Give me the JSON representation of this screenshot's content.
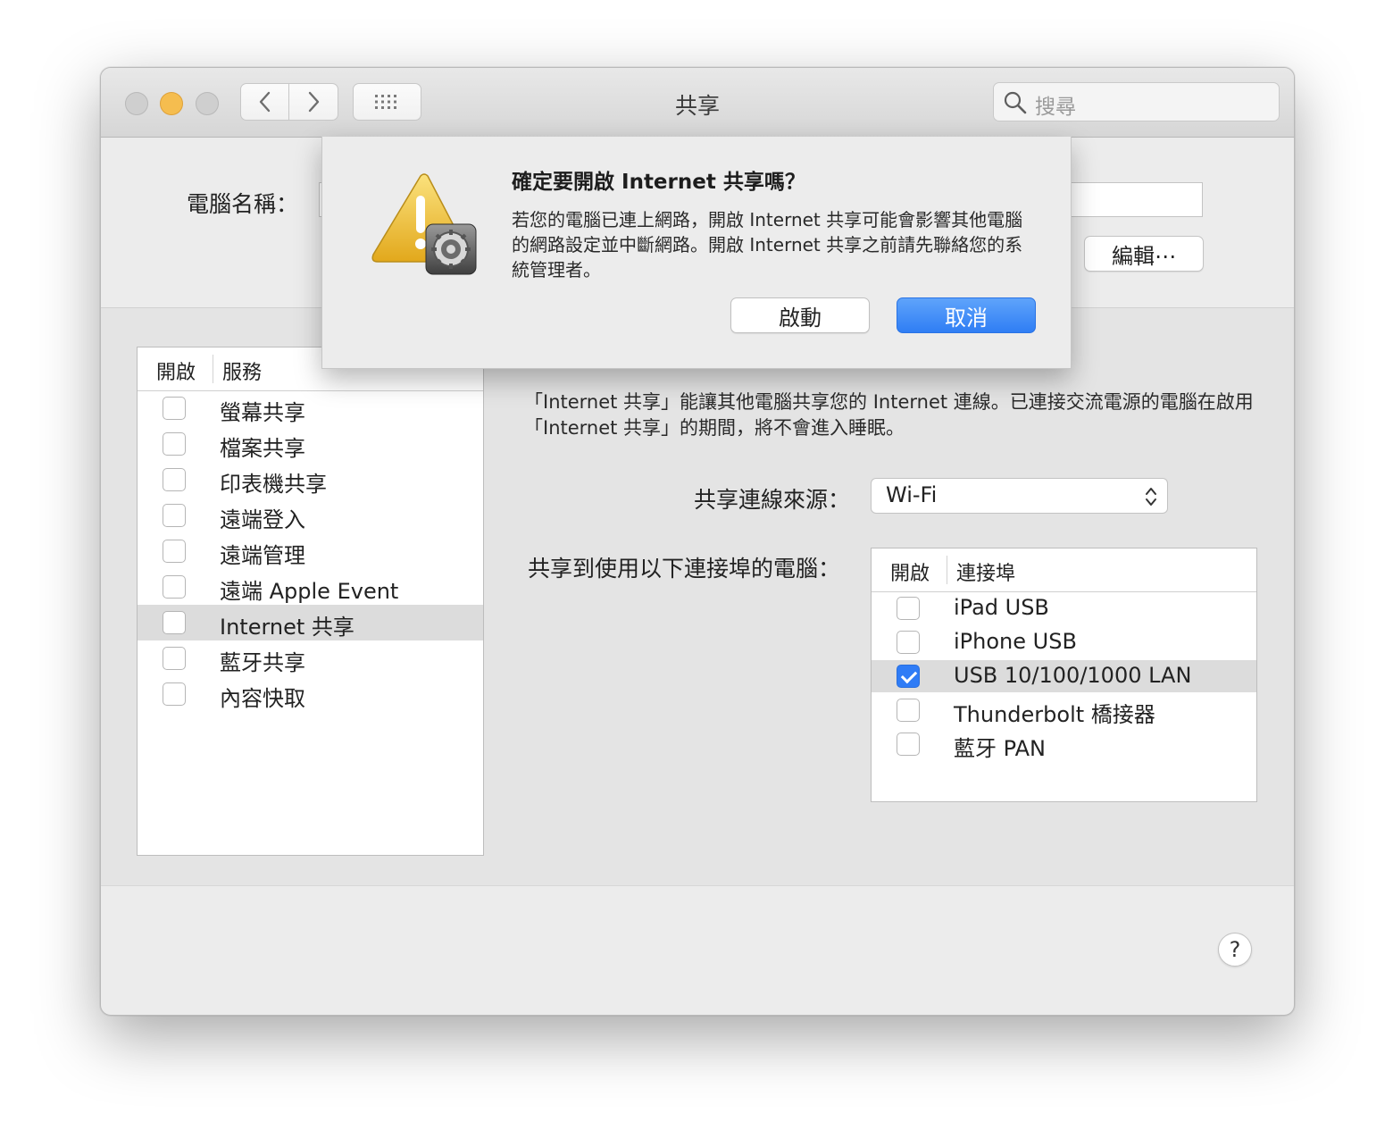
{
  "window": {
    "title": "共享"
  },
  "search": {
    "placeholder": "搜尋"
  },
  "computer_name": {
    "label": "電腦名稱：",
    "edit_button": "編輯⋯"
  },
  "services": {
    "header_on": "開啟",
    "header_service": "服務",
    "items": [
      {
        "label": "螢幕共享",
        "checked": false,
        "selected": false
      },
      {
        "label": "檔案共享",
        "checked": false,
        "selected": false
      },
      {
        "label": "印表機共享",
        "checked": false,
        "selected": false
      },
      {
        "label": "遠端登入",
        "checked": false,
        "selected": false
      },
      {
        "label": "遠端管理",
        "checked": false,
        "selected": false
      },
      {
        "label": "遠端 Apple Event",
        "checked": false,
        "selected": false
      },
      {
        "label": "Internet 共享",
        "checked": false,
        "selected": true
      },
      {
        "label": "藍牙共享",
        "checked": false,
        "selected": false
      },
      {
        "label": "內容快取",
        "checked": false,
        "selected": false
      }
    ]
  },
  "detail": {
    "description": "「Internet 共享」能讓其他電腦共享您的 Internet 連線。已連接交流電源的電腦在啟用「Internet 共享」的期間，將不會進入睡眠。",
    "share_from_label": "共享連線來源：",
    "share_from_value": "Wi-Fi",
    "ports_label": "共享到使用以下連接埠的電腦：",
    "ports_header_on": "開啟",
    "ports_header_port": "連接埠",
    "ports": [
      {
        "label": "iPad USB",
        "checked": false,
        "selected": false
      },
      {
        "label": "iPhone USB",
        "checked": false,
        "selected": false
      },
      {
        "label": "USB 10/100/1000 LAN",
        "checked": true,
        "selected": true
      },
      {
        "label": "Thunderbolt 橋接器",
        "checked": false,
        "selected": false
      },
      {
        "label": "藍牙 PAN",
        "checked": false,
        "selected": false
      }
    ]
  },
  "alert": {
    "title": "確定要開啟 Internet 共享嗎？",
    "message": "若您的電腦已連上網路，開啟 Internet 共享可能會影響其他電腦的網路設定並中斷網路。開啟 Internet 共享之前請先聯絡您的系統管理者。",
    "start_button": "啟動",
    "cancel_button": "取消"
  },
  "help_label": "?",
  "colors": {
    "accent": "#2f7cf6",
    "selection": "#dcdcdc",
    "minimize": "#f5bd4f"
  }
}
